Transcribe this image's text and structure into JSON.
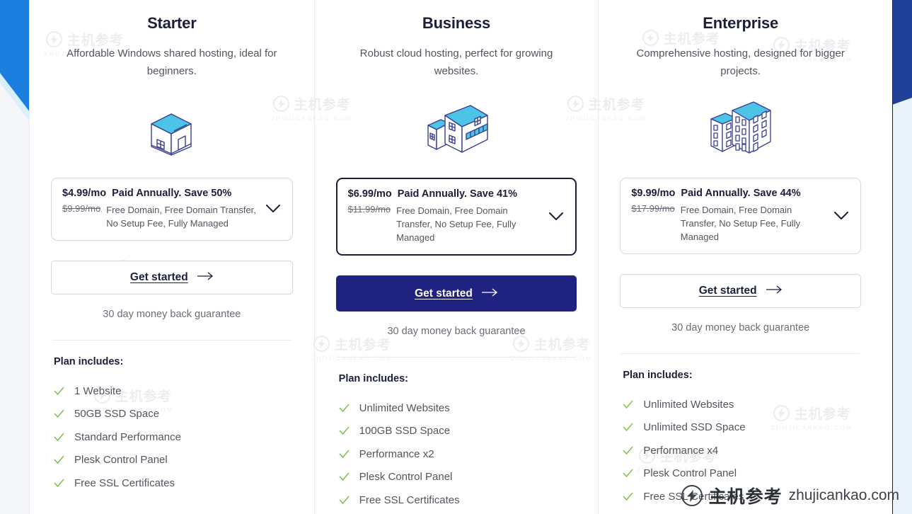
{
  "theme": {
    "navy": "#1b1f3b",
    "button_primary_bg": "#1f2280",
    "roof_cyan": "#4ec3e8",
    "tick_green": "#79c24a",
    "wedge_blue_left": "#1b7fe0",
    "wedge_blue_right": "#21409a",
    "divider": "#e9ebef"
  },
  "plans": [
    {
      "name": "Starter",
      "description": "Affordable Windows shared hosting, ideal for beginners.",
      "artwork": "house-small-icon",
      "price": {
        "current": "$4.99/mo",
        "terms": "Paid Annually. Save 50%",
        "original": "$9.99/mo",
        "features_inline": "Free Domain, Free Domain Transfer, No Setup Fee, Fully Managed",
        "expand_icon": "chevron-down-icon"
      },
      "cta": {
        "label": "Get started",
        "icon": "arrow-right-icon",
        "featured": false
      },
      "guarantee": "30 day money back guarantee",
      "includes_title": "Plan includes:",
      "features": [
        "1 Website",
        "50GB SSD Space",
        "Standard Performance",
        "Plesk Control Panel",
        "Free SSL Certificates"
      ]
    },
    {
      "name": "Business",
      "description": "Robust cloud hosting, perfect for growing websites.",
      "artwork": "building-medium-icon",
      "price": {
        "current": "$6.99/mo",
        "terms": "Paid Annually. Save 41%",
        "original": "$11.99/mo",
        "features_inline": "Free Domain, Free Domain Transfer, No Setup Fee, Fully Managed",
        "expand_icon": "chevron-down-icon"
      },
      "cta": {
        "label": "Get started",
        "icon": "arrow-right-icon",
        "featured": true
      },
      "guarantee": "30 day money back guarantee",
      "includes_title": "Plan includes:",
      "features": [
        "Unlimited Websites",
        "100GB SSD Space",
        "Performance x2",
        "Plesk Control Panel",
        "Free SSL Certificates"
      ]
    },
    {
      "name": "Enterprise",
      "description": "Comprehensive hosting, designed for bigger projects.",
      "artwork": "buildings-large-icon",
      "price": {
        "current": "$9.99/mo",
        "terms": "Paid Annually. Save 44%",
        "original": "$17.99/mo",
        "features_inline": "Free Domain, Free Domain Transfer, No Setup Fee, Fully Managed",
        "expand_icon": "chevron-down-icon"
      },
      "cta": {
        "label": "Get started",
        "icon": "arrow-right-icon",
        "featured": false
      },
      "guarantee": "30 day money back guarantee",
      "includes_title": "Plan includes:",
      "features": [
        "Unlimited Websites",
        "Unlimited SSD Space",
        "Performance x4",
        "Plesk Control Panel",
        "Free SSL Certificates"
      ]
    }
  ],
  "watermark": {
    "cn": "主机参考",
    "en": "ZHUJICANKAO.COM",
    "logo_icon": "lightning-circle-icon"
  },
  "brand": {
    "cn": "主机参考",
    "url": "zhujicankao.com",
    "logo_icon": "lightning-circle-icon"
  }
}
